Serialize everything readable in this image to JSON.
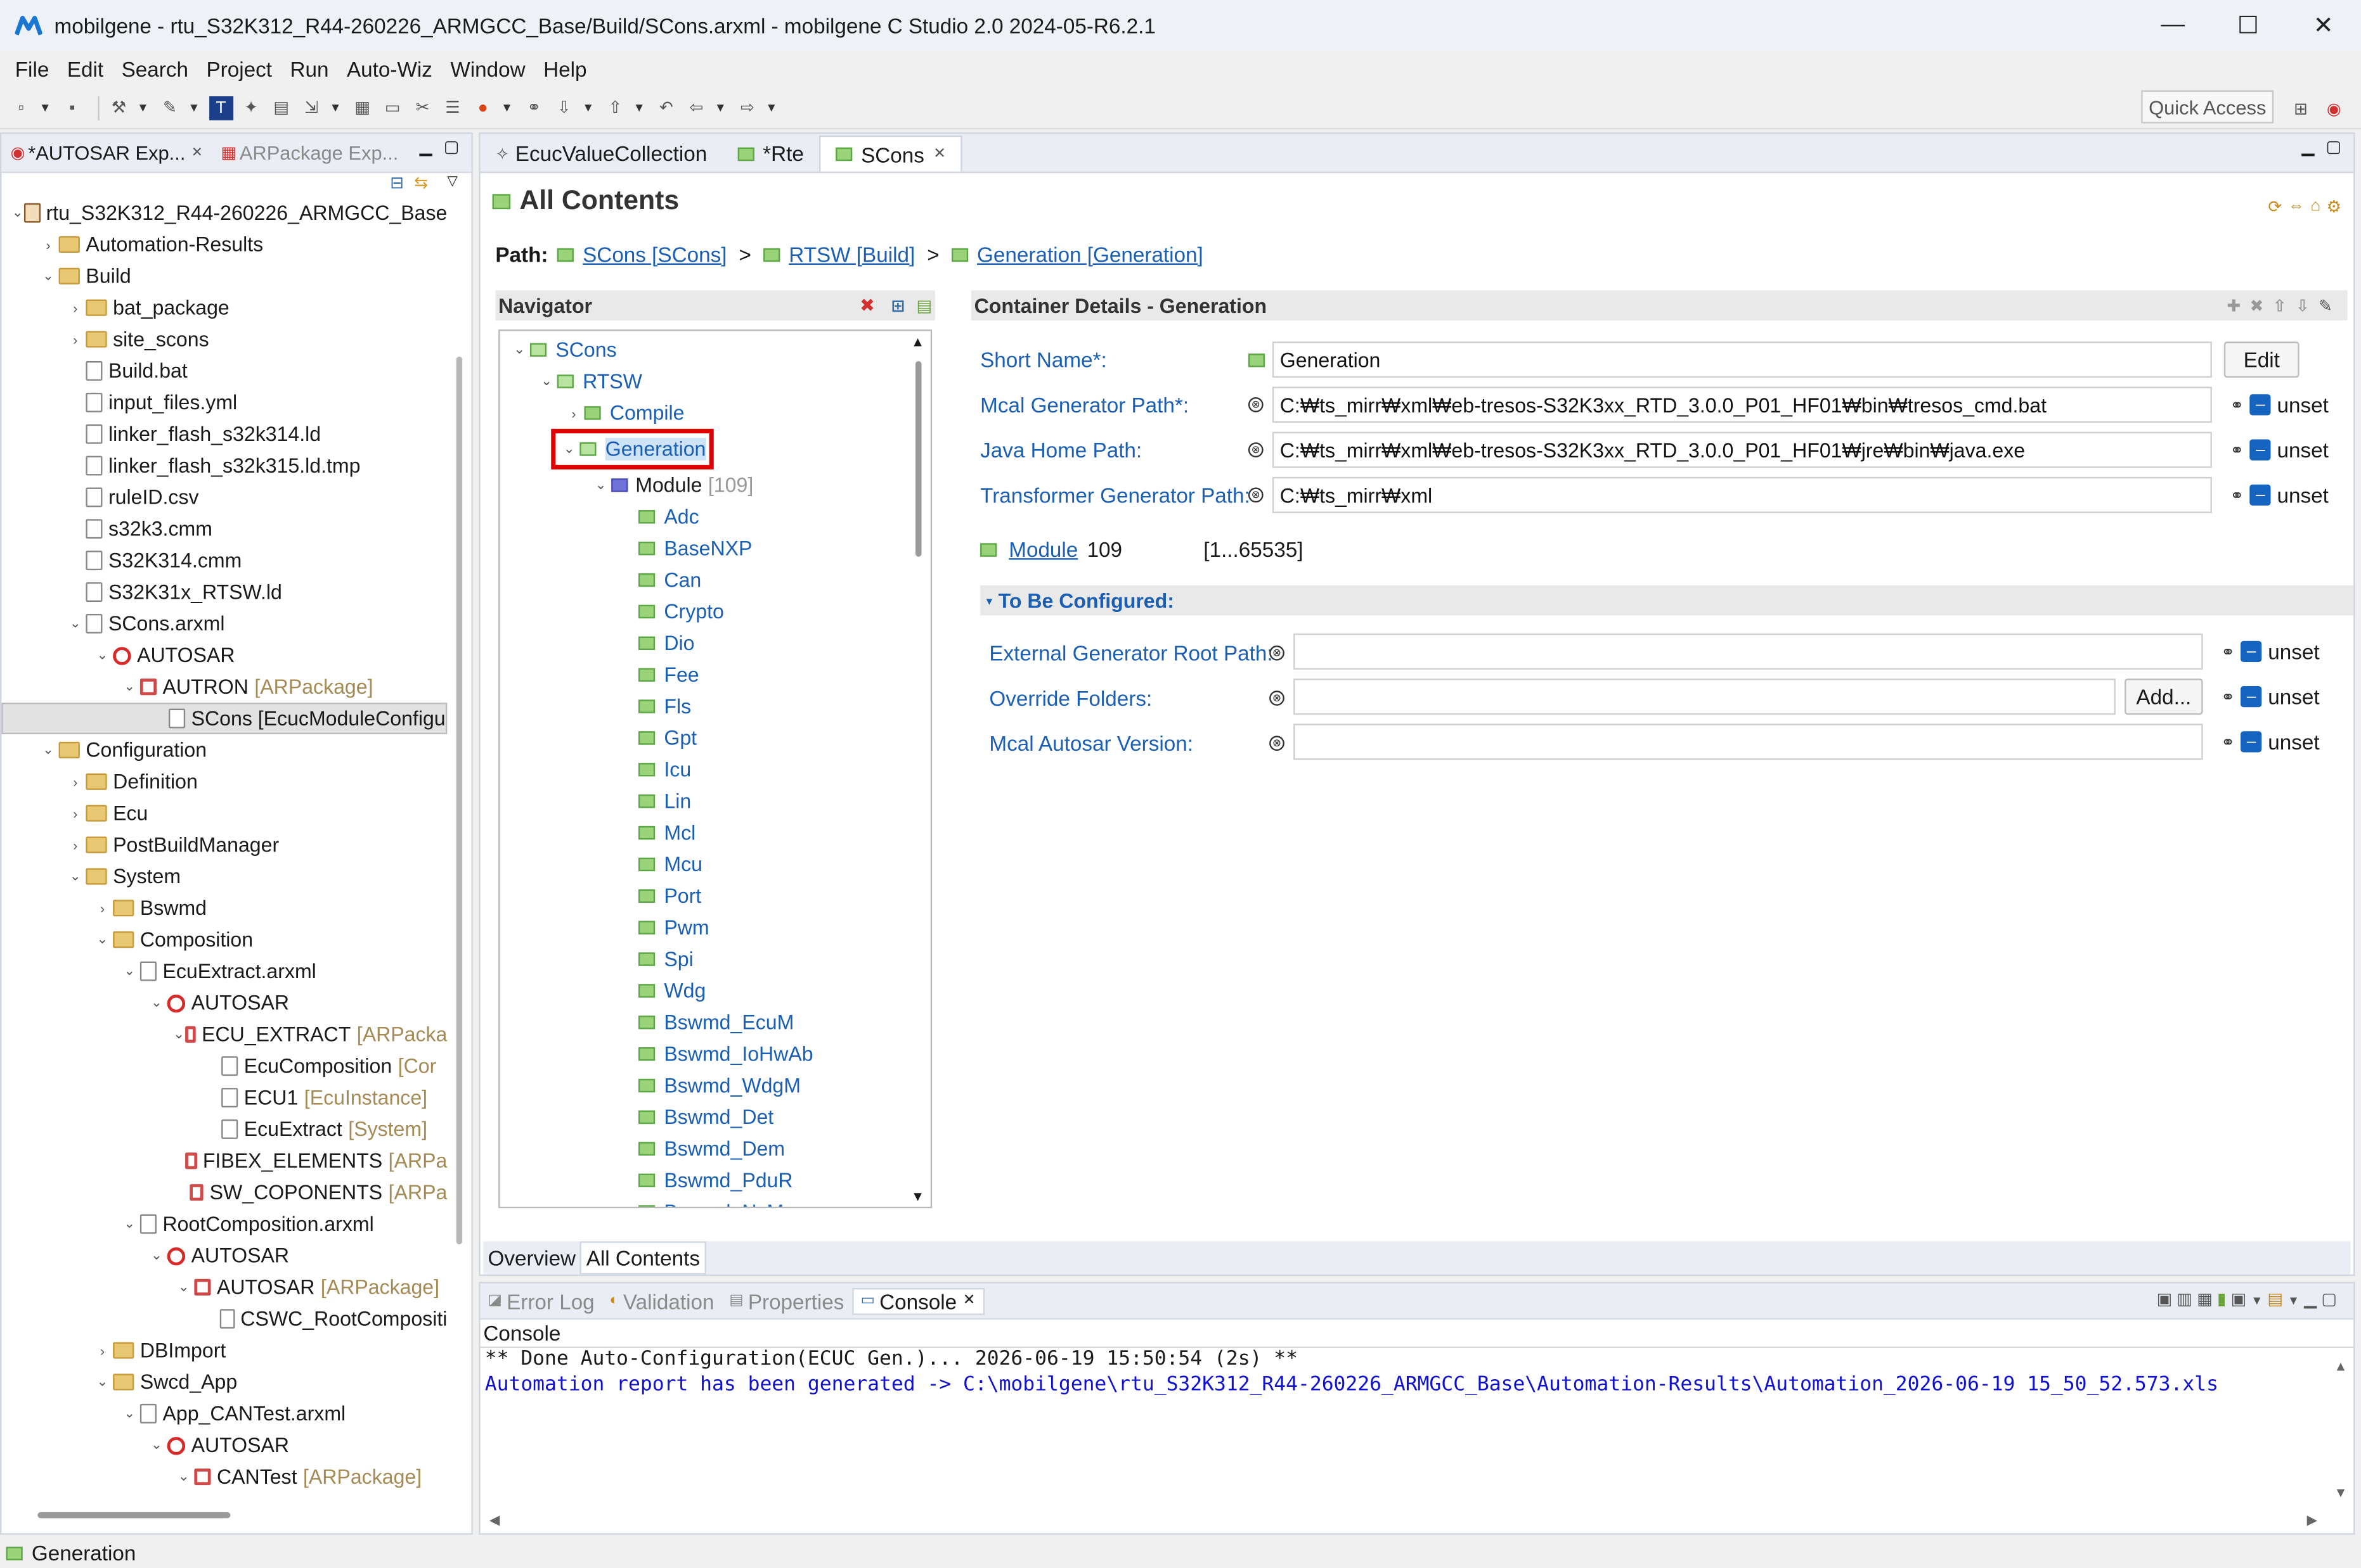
{
  "window": {
    "title": "mobilgene - rtu_S32K312_R44-260226_ARMGCC_Base/Build/SCons.arxml - mobilgene C Studio 2.0 2024-05-R6.2.1",
    "minimize": "—",
    "maximize": "☐",
    "close": "✕"
  },
  "menu": [
    "File",
    "Edit",
    "Search",
    "Project",
    "Run",
    "Auto-Wiz",
    "Window",
    "Help"
  ],
  "toolbar": {
    "quick_access": "Quick Access"
  },
  "left_panel": {
    "tabs": [
      {
        "label": "*AUTOSAR Exp...",
        "active": true
      },
      {
        "label": "ARPackage Exp...",
        "active": false
      }
    ],
    "tree": [
      {
        "depth": 0,
        "twisty": "v",
        "icon": "project",
        "label": "rtu_S32K312_R44-260226_ARMGCC_Base",
        "suffix": ""
      },
      {
        "depth": 1,
        "twisty": ">",
        "icon": "folder",
        "label": "Automation-Results",
        "suffix": ""
      },
      {
        "depth": 1,
        "twisty": "v",
        "icon": "folder",
        "label": "Build",
        "suffix": ""
      },
      {
        "depth": 2,
        "twisty": ">",
        "icon": "folder",
        "label": "bat_package",
        "suffix": ""
      },
      {
        "depth": 2,
        "twisty": ">",
        "icon": "folder",
        "label": "site_scons",
        "suffix": ""
      },
      {
        "depth": 2,
        "twisty": "",
        "icon": "file",
        "label": "Build.bat",
        "suffix": ""
      },
      {
        "depth": 2,
        "twisty": "",
        "icon": "file",
        "label": "input_files.yml",
        "suffix": ""
      },
      {
        "depth": 2,
        "twisty": "",
        "icon": "file",
        "label": "linker_flash_s32k314.ld",
        "suffix": ""
      },
      {
        "depth": 2,
        "twisty": "",
        "icon": "file",
        "label": "linker_flash_s32k315.ld.tmp",
        "suffix": ""
      },
      {
        "depth": 2,
        "twisty": "",
        "icon": "file",
        "label": "ruleID.csv",
        "suffix": ""
      },
      {
        "depth": 2,
        "twisty": "",
        "icon": "file",
        "label": "s32k3.cmm",
        "suffix": ""
      },
      {
        "depth": 2,
        "twisty": "",
        "icon": "file",
        "label": "S32K314.cmm",
        "suffix": ""
      },
      {
        "depth": 2,
        "twisty": "",
        "icon": "file",
        "label": "S32K31x_RTSW.ld",
        "suffix": ""
      },
      {
        "depth": 2,
        "twisty": "v",
        "icon": "file",
        "label": "SCons.arxml",
        "suffix": ""
      },
      {
        "depth": 3,
        "twisty": "v",
        "icon": "autosar",
        "label": "AUTOSAR",
        "suffix": ""
      },
      {
        "depth": 4,
        "twisty": "v",
        "icon": "package",
        "label": "AUTRON",
        "suffix": "[ARPackage]"
      },
      {
        "depth": 5,
        "twisty": "",
        "icon": "module",
        "label": "SCons [EcucModuleConfigu",
        "suffix": "",
        "selected": true
      },
      {
        "depth": 1,
        "twisty": "v",
        "icon": "folder",
        "label": "Configuration",
        "suffix": ""
      },
      {
        "depth": 2,
        "twisty": ">",
        "icon": "folder",
        "label": "Definition",
        "suffix": ""
      },
      {
        "depth": 2,
        "twisty": ">",
        "icon": "folder",
        "label": "Ecu",
        "suffix": ""
      },
      {
        "depth": 2,
        "twisty": ">",
        "icon": "folder",
        "label": "PostBuildManager",
        "suffix": ""
      },
      {
        "depth": 2,
        "twisty": "v",
        "icon": "folder",
        "label": "System",
        "suffix": ""
      },
      {
        "depth": 3,
        "twisty": ">",
        "icon": "folder",
        "label": "Bswmd",
        "suffix": ""
      },
      {
        "depth": 3,
        "twisty": "v",
        "icon": "folder",
        "label": "Composition",
        "suffix": ""
      },
      {
        "depth": 4,
        "twisty": "v",
        "icon": "file",
        "label": "EcuExtract.arxml",
        "suffix": ""
      },
      {
        "depth": 5,
        "twisty": "v",
        "icon": "autosar",
        "label": "AUTOSAR",
        "suffix": ""
      },
      {
        "depth": 6,
        "twisty": "v",
        "icon": "package",
        "label": "ECU_EXTRACT",
        "suffix": "[ARPacka"
      },
      {
        "depth": 7,
        "twisty": "",
        "icon": "composition",
        "label": "EcuComposition",
        "suffix": "[Cor"
      },
      {
        "depth": 7,
        "twisty": "",
        "icon": "instance",
        "label": "ECU1",
        "suffix": "[EcuInstance]"
      },
      {
        "depth": 7,
        "twisty": "",
        "icon": "system",
        "label": "EcuExtract",
        "suffix": "[System]"
      },
      {
        "depth": 6,
        "twisty": "",
        "icon": "package",
        "label": "FIBEX_ELEMENTS",
        "suffix": "[ARPa"
      },
      {
        "depth": 6,
        "twisty": "",
        "icon": "package",
        "label": "SW_COPONENTS",
        "suffix": "[ARPa"
      },
      {
        "depth": 4,
        "twisty": "v",
        "icon": "file",
        "label": "RootComposition.arxml",
        "suffix": ""
      },
      {
        "depth": 5,
        "twisty": "v",
        "icon": "autosar",
        "label": "AUTOSAR",
        "suffix": ""
      },
      {
        "depth": 6,
        "twisty": "v",
        "icon": "package",
        "label": "AUTOSAR",
        "suffix": "[ARPackage]"
      },
      {
        "depth": 7,
        "twisty": "",
        "icon": "composition",
        "label": "CSWC_RootCompositi",
        "suffix": ""
      },
      {
        "depth": 3,
        "twisty": ">",
        "icon": "folder",
        "label": "DBImport",
        "suffix": ""
      },
      {
        "depth": 3,
        "twisty": "v",
        "icon": "folder",
        "label": "Swcd_App",
        "suffix": ""
      },
      {
        "depth": 4,
        "twisty": "v",
        "icon": "file",
        "label": "App_CANTest.arxml",
        "suffix": ""
      },
      {
        "depth": 5,
        "twisty": "v",
        "icon": "autosar",
        "label": "AUTOSAR",
        "suffix": ""
      },
      {
        "depth": 6,
        "twisty": "v",
        "icon": "package",
        "label": "CANTest",
        "suffix": "[ARPackage]"
      }
    ]
  },
  "editor": {
    "tabs": [
      {
        "label": "EcucValueCollection",
        "active": false,
        "closable": false
      },
      {
        "label": "*Rte",
        "active": false,
        "closable": false
      },
      {
        "label": "SCons",
        "active": true,
        "closable": true
      }
    ],
    "heading": "All Contents",
    "path_label": "Path:",
    "path": [
      "SCons [SCons]",
      "RTSW [Build]",
      "Generation [Generation]"
    ],
    "path_sep": ">",
    "navigator": {
      "title": "Navigator",
      "rows": [
        {
          "depth": 0,
          "twisty": "v",
          "label": "SCons",
          "count": ""
        },
        {
          "depth": 1,
          "twisty": "v",
          "label": "RTSW",
          "count": ""
        },
        {
          "depth": 2,
          "twisty": ">",
          "label": "Compile",
          "count": ""
        },
        {
          "depth": 2,
          "twisty": "v",
          "label": "Generation",
          "count": "",
          "selected": true,
          "highlight": true
        },
        {
          "depth": 3,
          "twisty": "v",
          "label": "Module",
          "count": "[109]",
          "module": true
        },
        {
          "depth": 4,
          "twisty": "",
          "label": "Adc",
          "count": ""
        },
        {
          "depth": 4,
          "twisty": "",
          "label": "BaseNXP",
          "count": ""
        },
        {
          "depth": 4,
          "twisty": "",
          "label": "Can",
          "count": ""
        },
        {
          "depth": 4,
          "twisty": "",
          "label": "Crypto",
          "count": ""
        },
        {
          "depth": 4,
          "twisty": "",
          "label": "Dio",
          "count": ""
        },
        {
          "depth": 4,
          "twisty": "",
          "label": "Fee",
          "count": ""
        },
        {
          "depth": 4,
          "twisty": "",
          "label": "Fls",
          "count": ""
        },
        {
          "depth": 4,
          "twisty": "",
          "label": "Gpt",
          "count": ""
        },
        {
          "depth": 4,
          "twisty": "",
          "label": "Icu",
          "count": ""
        },
        {
          "depth": 4,
          "twisty": "",
          "label": "Lin",
          "count": ""
        },
        {
          "depth": 4,
          "twisty": "",
          "label": "Mcl",
          "count": ""
        },
        {
          "depth": 4,
          "twisty": "",
          "label": "Mcu",
          "count": ""
        },
        {
          "depth": 4,
          "twisty": "",
          "label": "Port",
          "count": ""
        },
        {
          "depth": 4,
          "twisty": "",
          "label": "Pwm",
          "count": ""
        },
        {
          "depth": 4,
          "twisty": "",
          "label": "Spi",
          "count": ""
        },
        {
          "depth": 4,
          "twisty": "",
          "label": "Wdg",
          "count": ""
        },
        {
          "depth": 4,
          "twisty": "",
          "label": "Bswmd_EcuM",
          "count": ""
        },
        {
          "depth": 4,
          "twisty": "",
          "label": "Bswmd_IoHwAb",
          "count": ""
        },
        {
          "depth": 4,
          "twisty": "",
          "label": "Bswmd_WdgM",
          "count": ""
        },
        {
          "depth": 4,
          "twisty": "",
          "label": "Bswmd_Det",
          "count": ""
        },
        {
          "depth": 4,
          "twisty": "",
          "label": "Bswmd_Dem",
          "count": ""
        },
        {
          "depth": 4,
          "twisty": "",
          "label": "Bswmd_PduR",
          "count": ""
        },
        {
          "depth": 4,
          "twisty": "",
          "label": "Bswmd_NvM",
          "count": ""
        }
      ]
    },
    "details": {
      "title": "Container Details - Generation",
      "short_name_label": "Short Name*:",
      "short_name_value": "Generation",
      "edit_button": "Edit",
      "mcal_gen_label": "Mcal Generator Path*:",
      "mcal_gen_value": "C:₩ts_mirr₩xml₩eb-tresos-S32K3xx_RTD_3.0.0_P01_HF01₩bin₩tresos_cmd.bat",
      "java_home_label": "Java Home Path:",
      "java_home_value": "C:₩ts_mirr₩xml₩eb-tresos-S32K3xx_RTD_3.0.0_P01_HF01₩jre₩bin₩java.exe",
      "transformer_label": "Transformer Generator Path:",
      "transformer_value": "C:₩ts_mirr₩xml",
      "module_link": "Module",
      "module_count": "109",
      "module_range": "[1...65535]",
      "to_be_configured": "To Be Configured:",
      "ext_gen_label": "External Generator Root Path:",
      "override_label": "Override Folders:",
      "add_button": "Add...",
      "mcal_autosar_label": "Mcal Autosar Version:",
      "unset": "unset"
    },
    "bottom_tabs": [
      {
        "label": "Overview",
        "active": false
      },
      {
        "label": "All Contents",
        "active": true
      }
    ]
  },
  "console": {
    "tabs": [
      {
        "label": "Error Log",
        "active": false
      },
      {
        "label": "Validation",
        "active": false
      },
      {
        "label": "Properties",
        "active": false
      },
      {
        "label": "Console",
        "active": true
      }
    ],
    "title": "Console",
    "lines": [
      "** Done Auto-Configuration(ECUC Gen.)... 2026-06-19 15:50:54 (2s) **",
      "Automation report has been generated -> C:\\mobilgene\\rtu_S32K312_R44-260226_ARMGCC_Base\\Automation-Results\\Automation_2026-06-19 15_50_52.573.xls"
    ]
  },
  "statusbar": {
    "text": "Generation"
  },
  "colors": {
    "link": "#1a5fb4",
    "highlight_box": "#e00000",
    "console_blue": "#1010d0",
    "unset_blue": "#1565c0"
  }
}
